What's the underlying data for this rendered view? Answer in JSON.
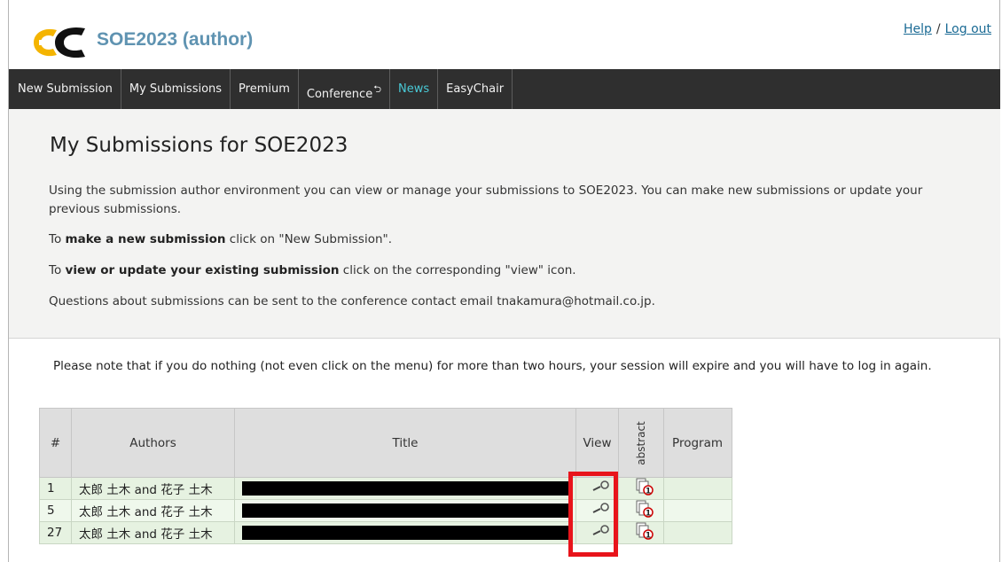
{
  "header": {
    "app_title": "SOE2023 (author)",
    "help_label": "Help",
    "separator": "/",
    "logout_label": "Log out"
  },
  "menu": {
    "items": [
      {
        "label": "New Submission"
      },
      {
        "label": "My Submissions"
      },
      {
        "label": "Premium"
      },
      {
        "label": "Conference"
      },
      {
        "label": "News"
      },
      {
        "label": "EasyChair"
      }
    ]
  },
  "info": {
    "title": "My Submissions for SOE2023",
    "intro": "Using the submission author environment you can view or manage your submissions to SOE2023. You can make new submissions or update your previous submissions.",
    "new_prefix": "To ",
    "new_bold": "make a new submission",
    "new_suffix": " click on \"New Submission\".",
    "update_prefix": "To ",
    "update_bold": "view or update your existing submission",
    "update_suffix": " click on the corresponding \"view\" icon.",
    "contact": "Questions about submissions can be sent to the conference contact email tnakamura@hotmail.co.jp."
  },
  "notice": "Please note that if you do nothing (not even click on the menu) for more than two hours, your session will expire and you will have to log in again.",
  "table": {
    "headers": {
      "num": "#",
      "authors": "Authors",
      "title": "Title",
      "view": "View",
      "abstract": "abstract",
      "program": "Program"
    },
    "rows": [
      {
        "num": "1",
        "authors": "太郎 土木 and 花子 土木"
      },
      {
        "num": "5",
        "authors": "太郎 土木 and 花子 土木"
      },
      {
        "num": "27",
        "authors": "太郎 土木 and 花子 土木"
      }
    ]
  },
  "icons": {
    "view": "magnifier-icon",
    "abstract": "abstract-document-icon"
  },
  "colors": {
    "menu_bg": "#2f2f2f",
    "menu_active": "#49c9d6",
    "title_blue": "#5f93b1",
    "row_green": "#e6f2e1",
    "highlight_red": "#e8141b"
  }
}
